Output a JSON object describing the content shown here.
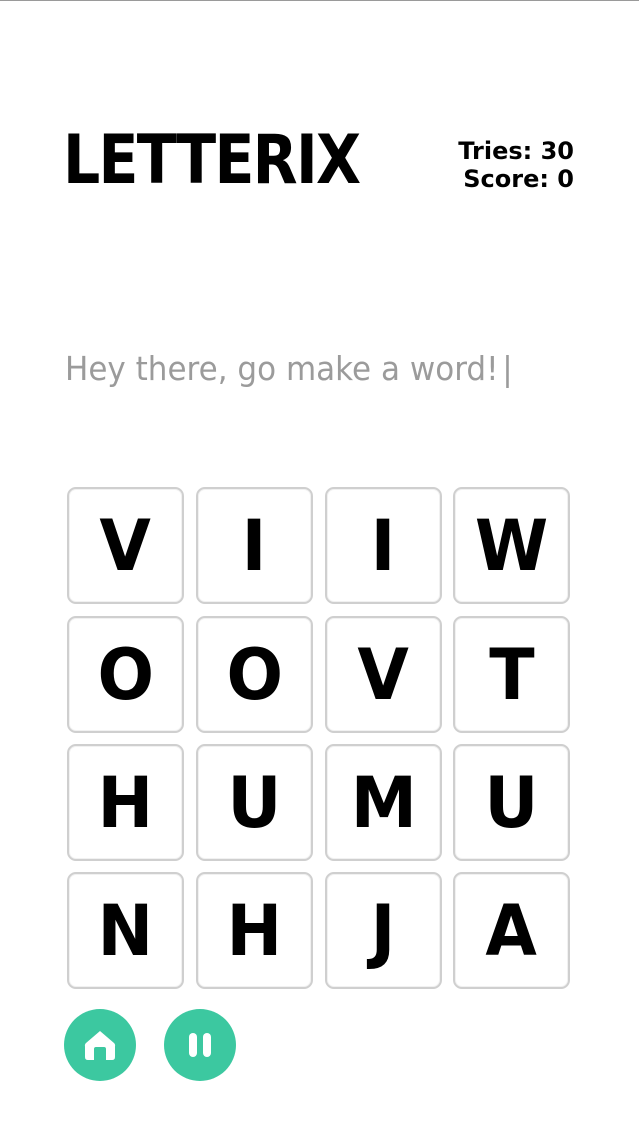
{
  "app": {
    "title": "LETTERIX"
  },
  "stats": {
    "tries_label": "Tries: 30",
    "score_label": "Score: 0"
  },
  "message": {
    "text": "Hey there, go make a word!",
    "caret": "|"
  },
  "board": {
    "rows": [
      [
        "V",
        "I",
        "I",
        "W"
      ],
      [
        "O",
        "O",
        "V",
        "T"
      ],
      [
        "H",
        "U",
        "M",
        "U"
      ],
      [
        "N",
        "H",
        "J",
        "A"
      ]
    ]
  },
  "controls": {
    "home_icon": "home-icon",
    "pause_icon": "pause-icon",
    "accent_color": "#3cc8a0"
  }
}
